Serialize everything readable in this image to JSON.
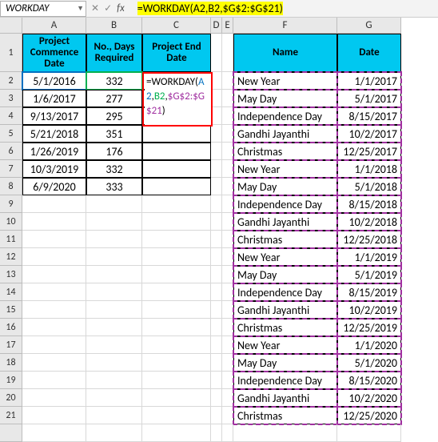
{
  "nameBox": "WORKDAY",
  "formulaBar": "=WORKDAY(A2,B2,$G$2:$G$21)",
  "columns": [
    "A",
    "B",
    "C",
    "D",
    "E",
    "F",
    "G"
  ],
  "headers": {
    "A": "Project Commence Date",
    "B": "No., Days Required",
    "C": "Project End Date",
    "F": "Name",
    "G": "Date"
  },
  "leftTable": [
    {
      "date": "5/1/2016",
      "days": 332
    },
    {
      "date": "1/6/2017",
      "days": 277
    },
    {
      "date": "9/13/2017",
      "days": 295
    },
    {
      "date": "5/21/2018",
      "days": 351
    },
    {
      "date": "1/26/2019",
      "days": 176
    },
    {
      "date": "10/3/2019",
      "days": 332
    },
    {
      "date": "6/9/2020",
      "days": 333
    }
  ],
  "formulaEdit": {
    "fn": "=WORKDAY(",
    "arg1": "A2",
    "sep1": ",",
    "arg2": "B2",
    "sep2": ",",
    "arg3": "$G$2:$G$21",
    "end": ")"
  },
  "rightTable": [
    {
      "name": "New Year",
      "date": "1/1/2017"
    },
    {
      "name": "May Day",
      "date": "5/1/2017"
    },
    {
      "name": "Independence Day",
      "date": "8/15/2017"
    },
    {
      "name": "Gandhi Jayanthi",
      "date": "10/2/2017"
    },
    {
      "name": "Christmas",
      "date": "12/25/2017"
    },
    {
      "name": "New Year",
      "date": "1/1/2018"
    },
    {
      "name": "May Day",
      "date": "5/1/2018"
    },
    {
      "name": "Independence Day",
      "date": "8/15/2018"
    },
    {
      "name": "Gandhi Jayanthi",
      "date": "10/2/2018"
    },
    {
      "name": "Christmas",
      "date": "12/25/2018"
    },
    {
      "name": "New Year",
      "date": "1/1/2019"
    },
    {
      "name": "May Day",
      "date": "5/1/2019"
    },
    {
      "name": "Independence Day",
      "date": "8/15/2019"
    },
    {
      "name": "Gandhi Jayanthi",
      "date": "10/2/2019"
    },
    {
      "name": "Christmas",
      "date": "12/25/2019"
    },
    {
      "name": "New Year",
      "date": "1/1/2020"
    },
    {
      "name": "May Day",
      "date": "5/1/2020"
    },
    {
      "name": "Independence Day",
      "date": "8/15/2020"
    },
    {
      "name": "Gandhi Jayanthi",
      "date": "10/2/2020"
    },
    {
      "name": "Christmas",
      "date": "12/25/2020"
    }
  ],
  "chart_data": {
    "type": "table",
    "note": "no chart; tabular data captured in leftTable/rightTable"
  }
}
